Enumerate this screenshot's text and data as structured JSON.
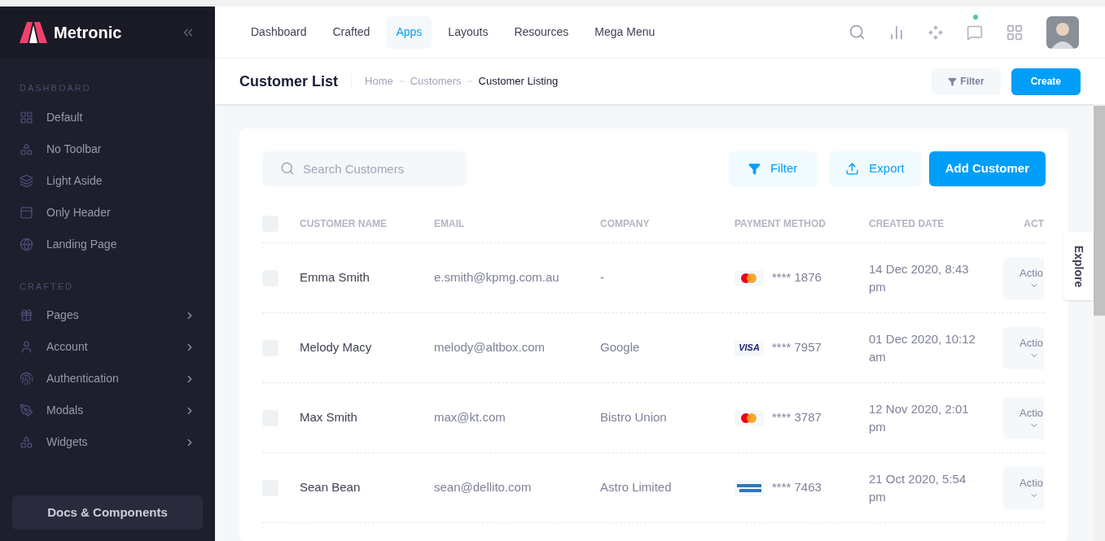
{
  "sidebar": {
    "brand": "Metronic",
    "sections": [
      {
        "title": "DASHBOARD",
        "items": [
          {
            "label": "Default",
            "expandable": false
          },
          {
            "label": "No Toolbar",
            "expandable": false
          },
          {
            "label": "Light Aside",
            "expandable": false
          },
          {
            "label": "Only Header",
            "expandable": false
          },
          {
            "label": "Landing Page",
            "expandable": false
          }
        ]
      },
      {
        "title": "CRAFTED",
        "items": [
          {
            "label": "Pages",
            "expandable": true
          },
          {
            "label": "Account",
            "expandable": true
          },
          {
            "label": "Authentication",
            "expandable": true
          },
          {
            "label": "Modals",
            "expandable": true
          },
          {
            "label": "Widgets",
            "expandable": true
          }
        ]
      }
    ],
    "docs_button": "Docs & Components"
  },
  "top_nav": [
    {
      "label": "Dashboard",
      "selected": false
    },
    {
      "label": "Crafted",
      "selected": false
    },
    {
      "label": "Apps",
      "selected": true
    },
    {
      "label": "Layouts",
      "selected": false
    },
    {
      "label": "Resources",
      "selected": false
    },
    {
      "label": "Mega Menu",
      "selected": false
    }
  ],
  "toolbar": {
    "title": "Customer List",
    "breadcrumb": [
      {
        "label": "Home",
        "current": false
      },
      {
        "label": "Customers",
        "current": false
      },
      {
        "label": "Customer Listing",
        "current": true
      }
    ],
    "filter_button": "Filter",
    "create_button": "Create"
  },
  "card": {
    "search": {
      "placeholder": "Search Customers"
    },
    "filter_button": "Filter",
    "export_button": "Export",
    "add_button": "Add Customer",
    "table": {
      "select_all_checked": false,
      "columns": [
        "CUSTOMER NAME",
        "EMAIL",
        "COMPANY",
        "PAYMENT METHOD",
        "CREATED DATE",
        "ACT"
      ],
      "rows": [
        {
          "checked": false,
          "name": "Emma Smith",
          "email": "e.smith@kpmg.com.au",
          "company": "-",
          "card": {
            "kind": "mastercard"
          },
          "number": "**** 1876",
          "date": "14 Dec 2020, 8:43 pm",
          "action": "Actio"
        },
        {
          "checked": false,
          "name": "Melody Macy",
          "email": "melody@altbox.com",
          "company": "Google",
          "card": {
            "kind": "visa",
            "text": "VISA"
          },
          "number": "**** 7957",
          "date": "01 Dec 2020, 10:12 am",
          "action": "Actio"
        },
        {
          "checked": false,
          "name": "Max Smith",
          "email": "max@kt.com",
          "company": "Bistro Union",
          "card": {
            "kind": "mastercard"
          },
          "number": "**** 3787",
          "date": "12 Nov 2020, 2:01 pm",
          "action": "Actio"
        },
        {
          "checked": false,
          "name": "Sean Bean",
          "email": "sean@dellito.com",
          "company": "Astro Limited",
          "card": {
            "kind": "amex"
          },
          "number": "**** 7463",
          "date": "21 Oct 2020, 5:54 pm",
          "action": "Actio"
        }
      ]
    }
  },
  "explore_tab": "Explore"
}
